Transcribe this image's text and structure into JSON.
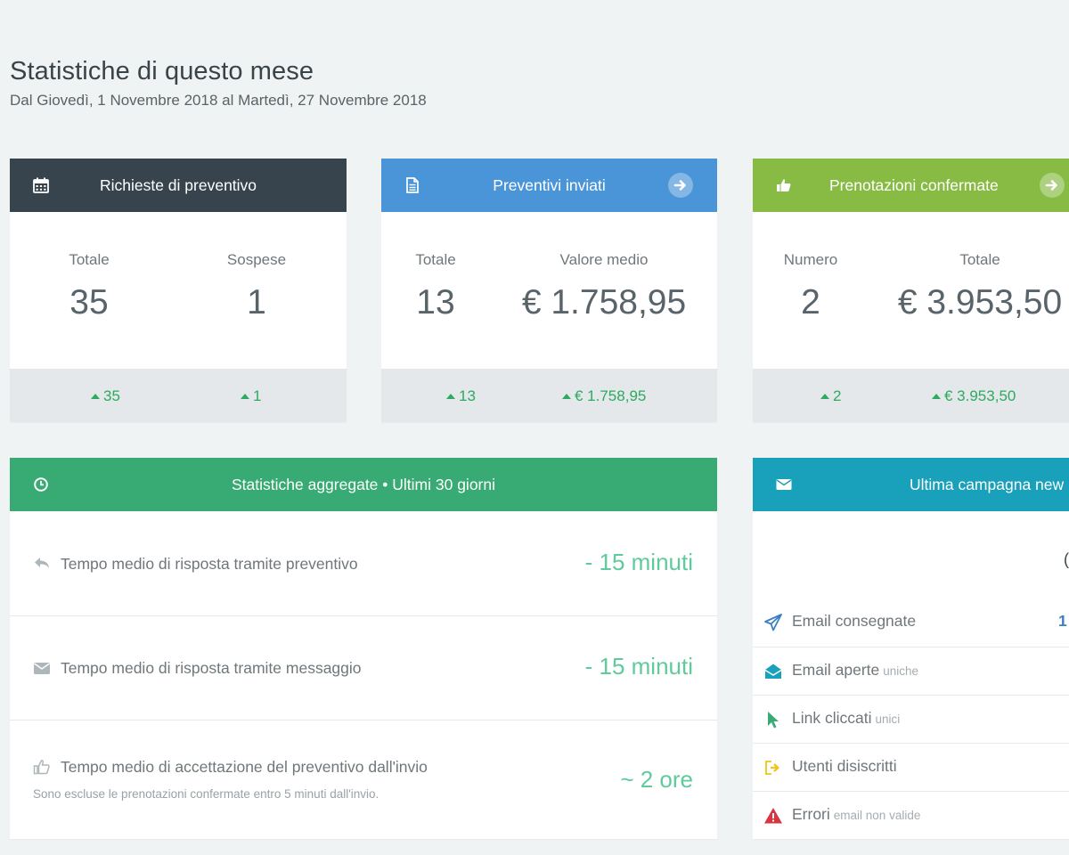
{
  "header": {
    "title": "Statistiche di questo mese",
    "subtitle": "Dal Giovedì, 1 Novembre 2018 al Martedì, 27 Novembre 2018"
  },
  "cards": [
    {
      "title": "Richieste di preventivo",
      "icon": "calendar-icon",
      "color": "#37444d",
      "stats": [
        {
          "label": "Totale",
          "value": "35",
          "delta": "35"
        },
        {
          "label": "Sospese",
          "value": "1",
          "delta": "1"
        }
      ]
    },
    {
      "title": "Preventivi inviati",
      "icon": "document-icon",
      "color": "#4a95d8",
      "stats": [
        {
          "label": "Totale",
          "value": "13",
          "delta": "13"
        },
        {
          "label": "Valore medio",
          "value": "€ 1.758,95",
          "delta": "€ 1.758,95"
        }
      ]
    },
    {
      "title": "Prenotazioni confermate",
      "icon": "thumbs-up-icon",
      "color": "#87bb44",
      "stats": [
        {
          "label": "Numero",
          "value": "2",
          "delta": "2"
        },
        {
          "label": "Totale",
          "value": "€ 3.953,50",
          "delta": "€ 3.953,50"
        }
      ]
    }
  ],
  "aggregate": {
    "title": "Statistiche aggregate • Ultimi 30 giorni",
    "color": "#37ab73",
    "rows": [
      {
        "icon": "reply-icon",
        "label": "Tempo medio di risposta tramite preventivo",
        "value": "- 15 minuti"
      },
      {
        "icon": "envelope-icon",
        "label": "Tempo medio di risposta tramite messaggio",
        "value": "- 15 minuti"
      },
      {
        "icon": "thumbs-up-icon",
        "label": "Tempo medio di accettazione del preventivo dall'invio",
        "note": "Sono escluse le prenotazioni confermate entro 5 minuti dall'invio.",
        "value": "~ 2 ore"
      }
    ]
  },
  "newsletter": {
    "title": "Ultima campagna new",
    "color": "#19a0bb",
    "partial_text": "(",
    "rows": [
      {
        "icon": "paper-plane-icon",
        "label": "Email consegnate",
        "sub": "",
        "value": "1",
        "value_color": "#3a7fc4"
      },
      {
        "icon": "envelope-open-icon",
        "label": "Email aperte",
        "sub": "uniche",
        "value": "",
        "value_color": "#6f777b"
      },
      {
        "icon": "cursor-icon",
        "label": "Link cliccati",
        "sub": "unici",
        "value": "",
        "value_color": "#6f777b"
      },
      {
        "icon": "sign-out-icon",
        "label": "Utenti disiscritti",
        "sub": "",
        "value": "",
        "value_color": "#6f777b"
      },
      {
        "icon": "warning-icon",
        "label": "Errori",
        "sub": "email non valide",
        "value": "",
        "value_color": "#6f777b"
      }
    ]
  }
}
